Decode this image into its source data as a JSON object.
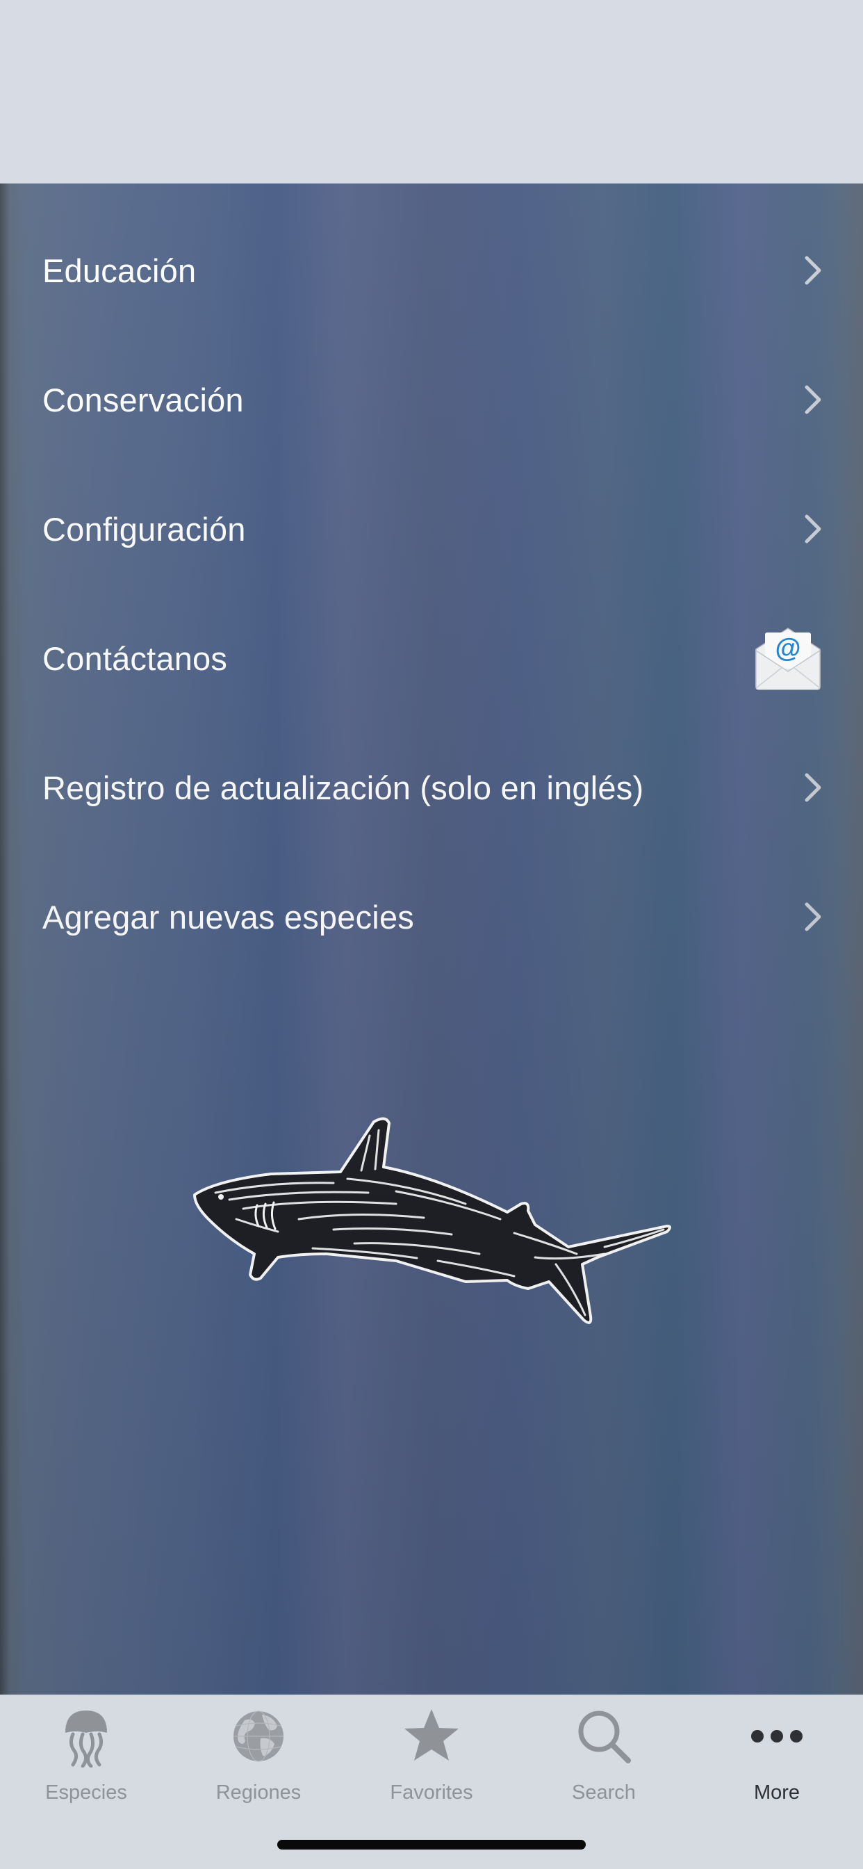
{
  "menu": {
    "items": [
      {
        "label": "Educación",
        "accessory": "chevron-right-icon"
      },
      {
        "label": "Conservación",
        "accessory": "chevron-right-icon"
      },
      {
        "label": "Configuración",
        "accessory": "chevron-right-icon"
      },
      {
        "label": "Contáctanos",
        "accessory": "mail-icon"
      },
      {
        "label": "Registro de actualización (solo en inglés)",
        "accessory": "chevron-right-icon"
      },
      {
        "label": "Agregar nuevas especies",
        "accessory": "chevron-right-icon"
      }
    ]
  },
  "illustration": {
    "icon": "shark-illustration"
  },
  "tab_bar": {
    "tabs": [
      {
        "label": "Especies",
        "icon": "jellyfish-icon",
        "active": false
      },
      {
        "label": "Regiones",
        "icon": "globe-icon",
        "active": false
      },
      {
        "label": "Favorites",
        "icon": "star-icon",
        "active": false
      },
      {
        "label": "Search",
        "icon": "search-icon",
        "active": false
      },
      {
        "label": "More",
        "icon": "more-icon",
        "active": true
      }
    ]
  },
  "colors": {
    "background_blue": "#4f6180",
    "nav_bar": "#d7dce4",
    "tab_bar": "#d6dbe2",
    "tab_inactive": "#8f9398",
    "tab_active": "#2f3033",
    "mail_accent": "#1f86d4"
  }
}
